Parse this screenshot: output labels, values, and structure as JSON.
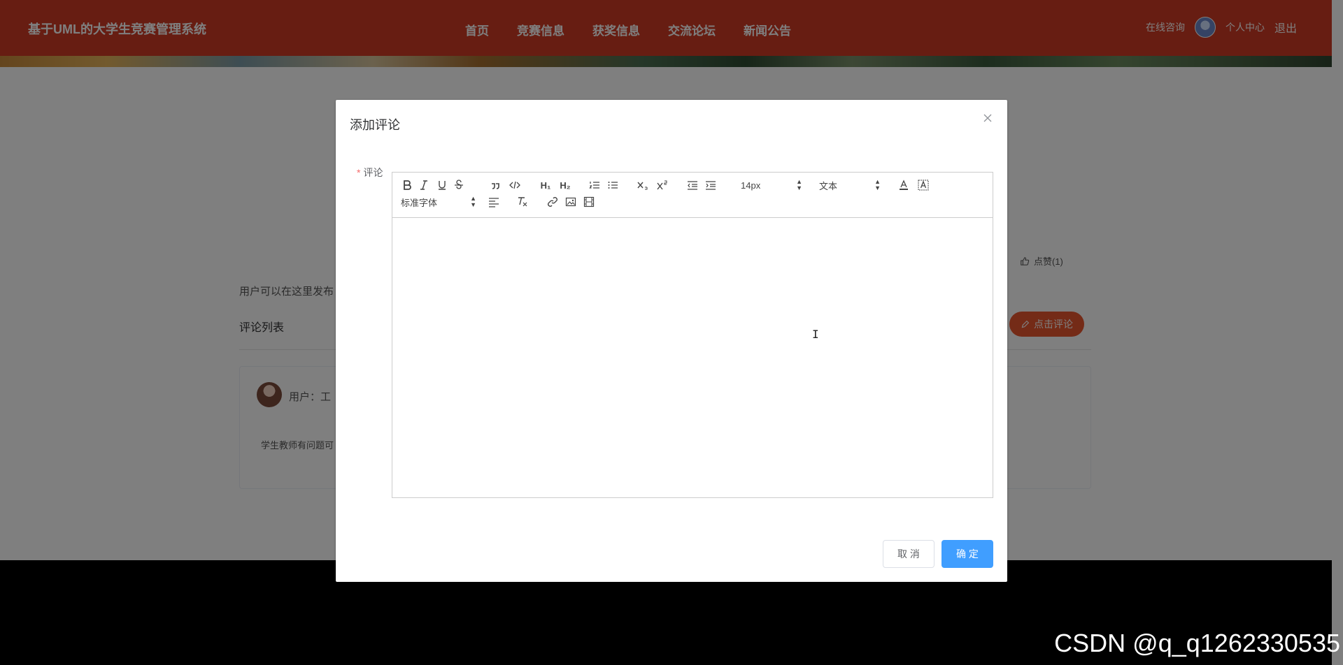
{
  "header": {
    "brand": "基于UML的大学生竞赛管理系统",
    "nav": [
      "首页",
      "竞赛信息",
      "获奖信息",
      "交流论坛",
      "新闻公告"
    ],
    "online_consult": "在线咨询",
    "user_center": "个人中心",
    "logout": "退出"
  },
  "page": {
    "like_label": "点赞(1)",
    "intro": "用户可以在这里发布",
    "comments_title": "评论列表",
    "comment_button": "点击评论",
    "comment": {
      "user": "用户：工",
      "text": "学生教师有问题可"
    }
  },
  "dialog": {
    "title": "添加评论",
    "field_label": "评论",
    "required_mark": "*",
    "toolbar": {
      "font_size": "14px",
      "header_select": "文本",
      "font_family": "标准字体",
      "h1": "H₁",
      "h2": "H₂"
    },
    "cancel_label": "取 消",
    "confirm_label": "确 定"
  },
  "watermark": "CSDN @q_q1262330535",
  "colors": {
    "header_bg": "#cf3a24",
    "primary": "#409eff",
    "comment_btn": "#e8562f",
    "required": "#f56c6c"
  }
}
